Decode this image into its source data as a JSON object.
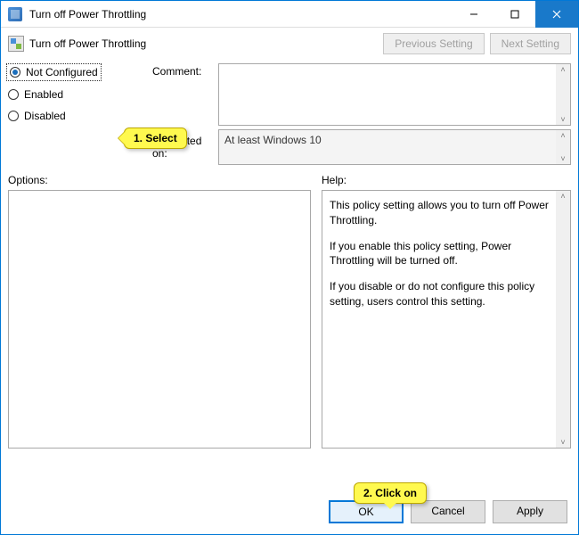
{
  "window": {
    "title": "Turn off Power Throttling"
  },
  "header": {
    "policy_title": "Turn off Power Throttling",
    "prev_btn": "Previous Setting",
    "next_btn": "Next Setting"
  },
  "radios": {
    "not_configured": "Not Configured",
    "enabled": "Enabled",
    "disabled": "Disabled"
  },
  "labels": {
    "comment": "Comment:",
    "supported_on": "Supported on:",
    "options": "Options:",
    "help": "Help:"
  },
  "supported_text": "At least Windows 10",
  "help": {
    "p1": "This policy setting allows you to turn off Power Throttling.",
    "p2": "If you enable this policy setting, Power Throttling will be turned off.",
    "p3": "If you disable or do not configure this policy setting, users control this setting."
  },
  "buttons": {
    "ok": "OK",
    "cancel": "Cancel",
    "apply": "Apply"
  },
  "callouts": {
    "c1": "1. Select",
    "c2": "2. Click on"
  }
}
